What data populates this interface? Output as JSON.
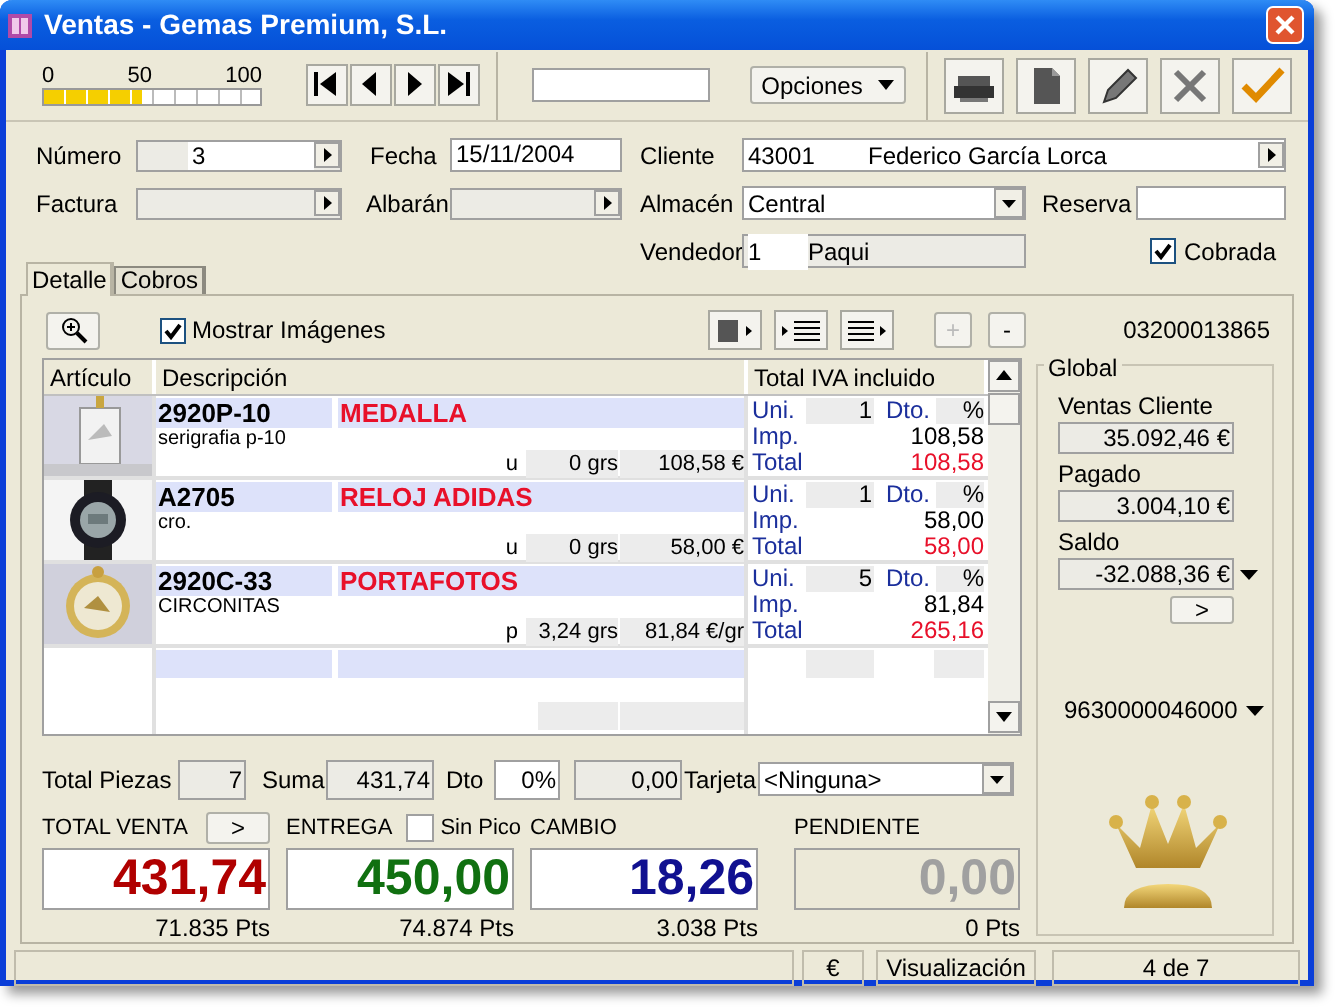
{
  "window": {
    "title": "Ventas - Gemas Premium, S.L."
  },
  "toolbar": {
    "meter": {
      "ticks": [
        "0",
        "50",
        "100"
      ],
      "level": 0.45
    },
    "options_button": "Opciones"
  },
  "form": {
    "numero": {
      "label": "Número",
      "value": "3"
    },
    "fecha": {
      "label": "Fecha",
      "value": "15/11/2004"
    },
    "cliente": {
      "label": "Cliente",
      "code": "43001",
      "name": "Federico García Lorca"
    },
    "factura": {
      "label": "Factura"
    },
    "albaran": {
      "label": "Albarán"
    },
    "almacen": {
      "label": "Almacén",
      "value": "Central"
    },
    "reserva": {
      "label": "Reserva"
    },
    "vendedor": {
      "label": "Vendedor",
      "code": "1",
      "name": "Paqui"
    },
    "cobrada": {
      "label": "Cobrada",
      "checked": true
    }
  },
  "tabs": [
    {
      "label": "Detalle",
      "selected": true
    },
    {
      "label": "Cobros",
      "selected": false
    }
  ],
  "detail": {
    "show_images": {
      "label": "Mostrar Imágenes",
      "checked": true
    },
    "add_button": "+",
    "remove_button": "-",
    "reference": "03200013865",
    "columns": [
      "Artículo",
      "Descripción",
      "Total IVA incluido"
    ],
    "rows": [
      {
        "code": "2920P-10",
        "name": "MEDALLA",
        "note": "serigrafia p-10",
        "unit": "u",
        "weight": "0 grs",
        "price": "108,58 €",
        "uni_label": "Uni.",
        "uni": "1",
        "dto_label": "Dto.",
        "dto": "%",
        "imp_label": "Imp.",
        "imp": "108,58",
        "total_label": "Total",
        "total": "108,58"
      },
      {
        "code": "A2705",
        "name": "RELOJ ADIDAS",
        "note": "cro.",
        "unit": "u",
        "weight": "0 grs",
        "price": "58,00 €",
        "uni_label": "Uni.",
        "uni": "1",
        "dto_label": "Dto.",
        "dto": "%",
        "imp_label": "Imp.",
        "imp": "58,00",
        "total_label": "Total",
        "total": "58,00"
      },
      {
        "code": "2920C-33",
        "name": "PORTAFOTOS",
        "note": "CIRCONITAS",
        "unit": "p",
        "weight": "3,24 grs",
        "price": "81,84 €/gr",
        "uni_label": "Uni.",
        "uni": "5",
        "dto_label": "Dto.",
        "dto": "%",
        "imp_label": "Imp.",
        "imp": "81,84",
        "total_label": "Total",
        "total": "265,16"
      }
    ]
  },
  "global": {
    "title": "Global",
    "fields": [
      {
        "label": "Ventas Cliente",
        "value": "35.092,46 €"
      },
      {
        "label": "Pagado",
        "value": "3.004,10 €"
      },
      {
        "label": "Saldo",
        "value": "-32.088,36 €"
      }
    ],
    "more_button": ">",
    "code": "9630000046000"
  },
  "summary": {
    "total_piezas": {
      "label": "Total Piezas",
      "value": "7"
    },
    "suma": {
      "label": "Suma",
      "value": "431,74"
    },
    "dto": {
      "label": "Dto",
      "percent": "0%",
      "amount": "0,00"
    },
    "tarjeta": {
      "label": "Tarjeta",
      "value": "<Ninguna>"
    }
  },
  "totals": [
    {
      "kind": "button",
      "label": "TOTAL VENTA",
      "button": ">",
      "value": "431,74",
      "pts": "71.835 Pts",
      "color": "#b00000"
    },
    {
      "kind": "checkbox",
      "label": "ENTREGA",
      "check_label": "Sin Pico",
      "checked": false,
      "value": "450,00",
      "pts": "74.874 Pts",
      "color": "#107010"
    },
    {
      "kind": "plain",
      "label": "CAMBIO",
      "value": "18,26",
      "pts": "3.038 Pts",
      "color": "#101090"
    },
    {
      "kind": "disabled",
      "label": "PENDIENTE",
      "value": "0,00",
      "pts": "0 Pts",
      "color": "#a0a0a0"
    }
  ],
  "status_bar": [
    "€",
    "Visualización",
    "4 de 7"
  ]
}
